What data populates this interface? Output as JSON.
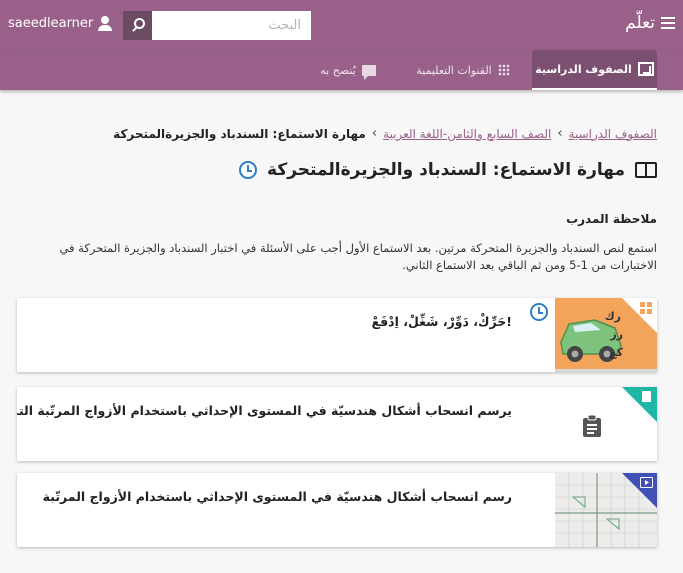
{
  "header": {
    "app_title": "تعلّم",
    "menu_icon": "menu-icon",
    "user_icon": "person-icon",
    "username": "saeedlearner",
    "search_placeholder": "البحث",
    "search_icon": "search-icon",
    "colors": {
      "bar": "#996189",
      "search_button": "#6b4a63",
      "active_tab": "#7a4f6f"
    }
  },
  "tabs": [
    {
      "label": "الصفوف الدراسية",
      "icon": "classes-icon",
      "active": true
    },
    {
      "label": "القنوات التعليمية",
      "icon": "apps-grid-icon",
      "active": false
    },
    {
      "label": "يُنصح به",
      "icon": "recommended-chat-icon",
      "active": false
    }
  ],
  "breadcrumb": {
    "items": [
      "الصفوف الدراسية",
      "الصف السابع والثامن-اللغة العربية"
    ],
    "separator": "›",
    "current": "مهارة الاستماع: السندباد والجزيرةالمتحركة"
  },
  "page": {
    "title": "مهارة الاستماع: السندباد والجزيرةالمتحركة",
    "title_icon": "book-icon",
    "status_icon": "clock-icon",
    "coach_label": "ملاحظة المدرب",
    "coach_text": "استمع لنص السندباد والجزيرة المتحركة مرتين. بعد الاستماع الأول أجب على الأسئلة في اختبار السندباد والجزيرة المتحركة في الاختبارات من 1-5 ومن ثم الباقي بعد الاستماع الثاني."
  },
  "cards": [
    {
      "title": "!حَرِّكْ، دَوِّرْ، شَغِّلْ، اِدْفَعْ",
      "kind": "lesson",
      "corner_color": "#ffffff",
      "status_icon": "clock-icon",
      "kind_icon": "apps-icon",
      "thumb_letters": "ر ك ر ز ك غ"
    },
    {
      "title": "يرسم انسحاب أشكال هندسيّة في المستوى الإحداثي باستخدام الأزواج المرتّبة التمرين",
      "kind": "exercise",
      "corner_color": "#1fb6a6",
      "kind_icon": "clipboard-icon"
    },
    {
      "title": "رسم انسحاب أشكال هندسيّة في المستوى الإحداثي باستخدام الأزواج المرتّبة",
      "kind": "video",
      "corner_color": "#4050b5",
      "kind_icon": "video-icon"
    }
  ]
}
